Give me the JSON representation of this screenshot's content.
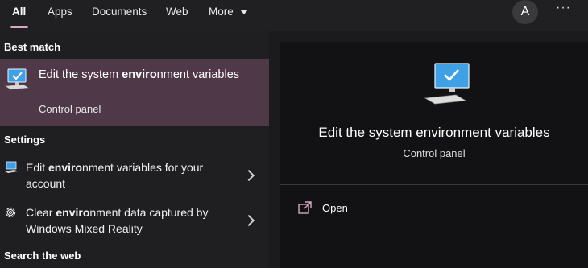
{
  "tabs": {
    "all": "All",
    "apps": "Apps",
    "documents": "Documents",
    "web": "Web",
    "more": "More"
  },
  "account": {
    "avatar_letter": "A",
    "options": "···"
  },
  "sections": {
    "best_match": "Best match",
    "settings": "Settings",
    "search_web": "Search the web"
  },
  "best_match": {
    "title_pre": "Edit the system ",
    "title_bold": "enviro",
    "title_post": "nment variables",
    "subtitle": "Control panel"
  },
  "settings_items": [
    {
      "pre": "Edit ",
      "bold": "enviro",
      "post": "nment variables for your account"
    },
    {
      "pre": "Clear ",
      "bold": "enviro",
      "post": "nment data captured by Windows Mixed Reality"
    }
  ],
  "preview": {
    "title": "Edit the system environment variables",
    "subtitle": "Control panel",
    "action_open": "Open"
  },
  "colors": {
    "accent": "#d8a7c2",
    "selected_bg": "#4f3847",
    "monitor_blue": "#3fa0e6"
  },
  "icons": {
    "best_match": "computer-monitor-icon",
    "settings_1": "laptop-icon",
    "settings_2": "gear-icon",
    "open_action": "open-external-icon",
    "chevron": "chevron-right-icon"
  }
}
